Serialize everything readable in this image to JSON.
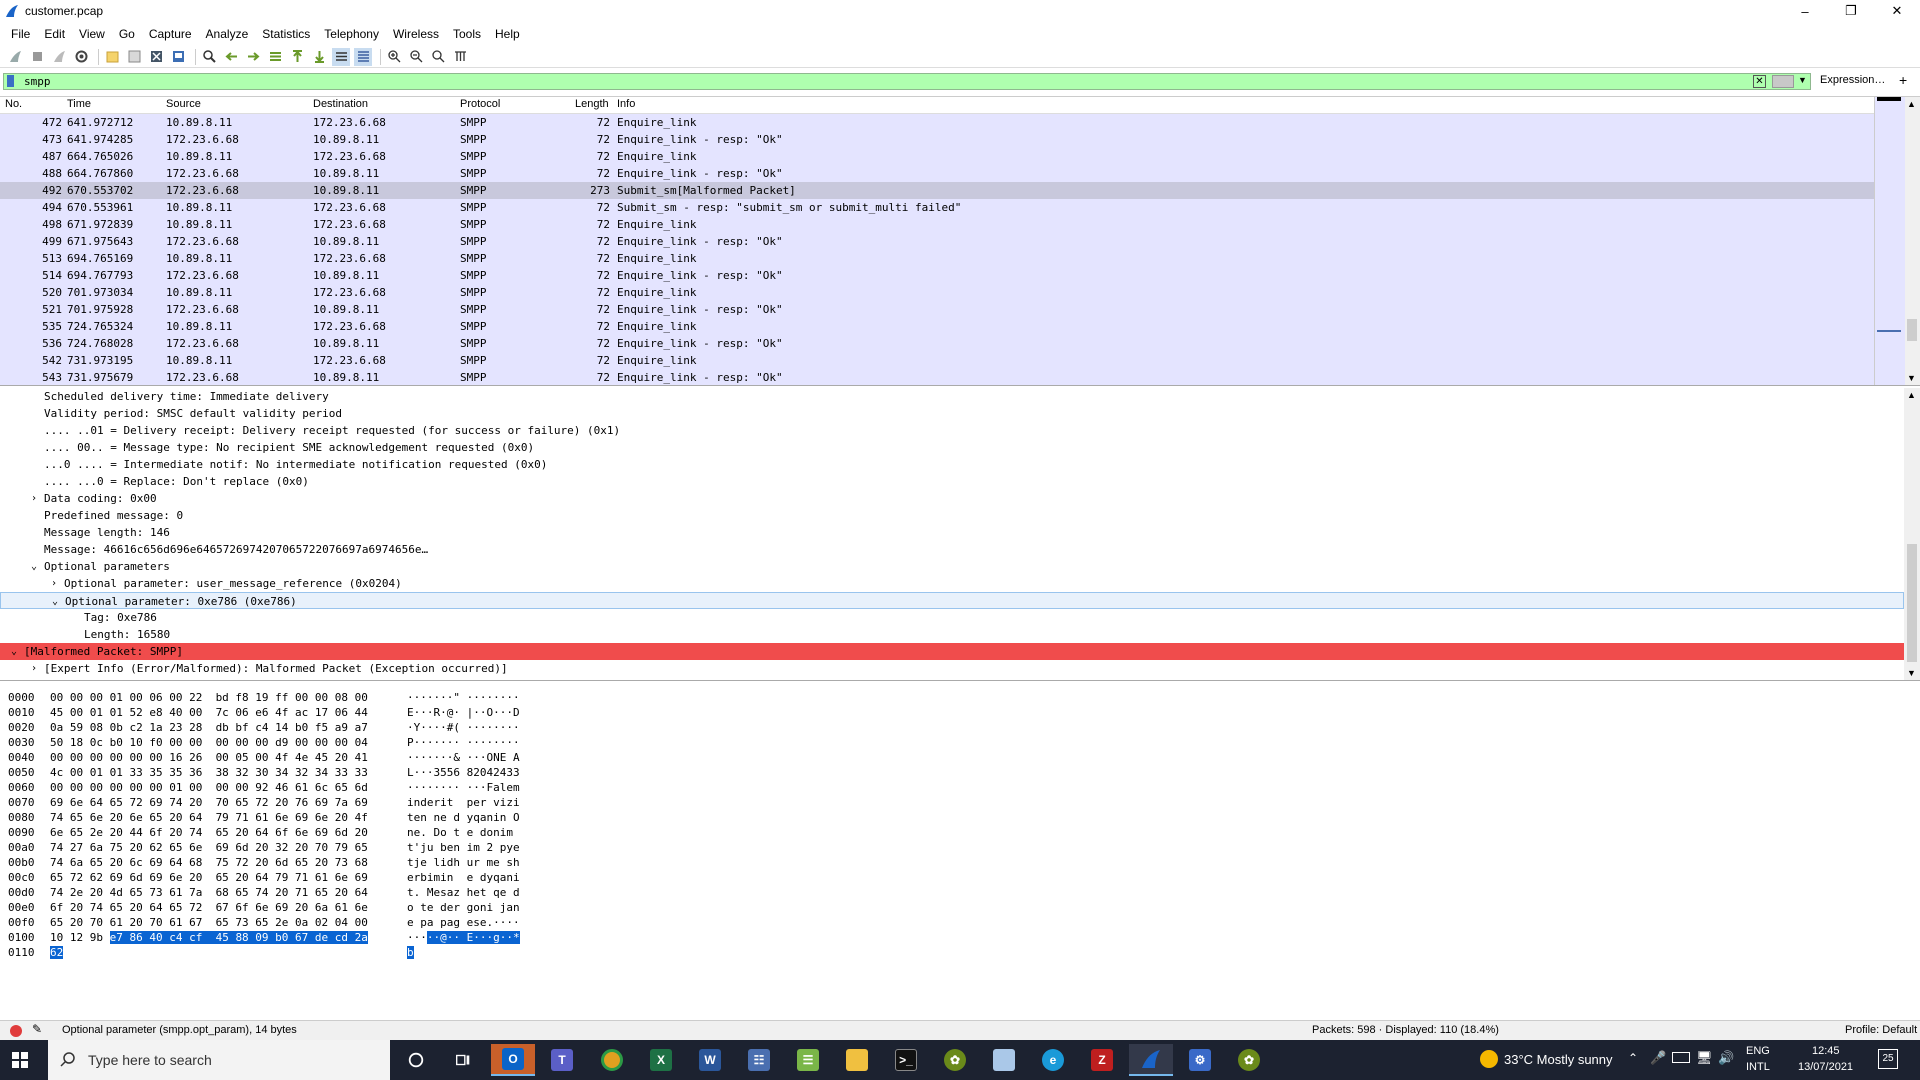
{
  "window": {
    "title": "customer.pcap"
  },
  "menu": [
    "File",
    "Edit",
    "View",
    "Go",
    "Capture",
    "Analyze",
    "Statistics",
    "Telephony",
    "Wireless",
    "Tools",
    "Help"
  ],
  "filter": {
    "value": "smpp",
    "expression_label": "Expression…",
    "plus_label": "+"
  },
  "packet_list": {
    "headers": {
      "no": "No.",
      "time": "Time",
      "source": "Source",
      "destination": "Destination",
      "protocol": "Protocol",
      "length": "Length",
      "info": "Info"
    },
    "rows": [
      {
        "no": "472",
        "time": "641.972712",
        "src": "10.89.8.11",
        "dst": "172.23.6.68",
        "proto": "SMPP",
        "len": "72",
        "info": "Enquire_link"
      },
      {
        "no": "473",
        "time": "641.974285",
        "src": "172.23.6.68",
        "dst": "10.89.8.11",
        "proto": "SMPP",
        "len": "72",
        "info": "Enquire_link - resp: \"Ok\""
      },
      {
        "no": "487",
        "time": "664.765026",
        "src": "10.89.8.11",
        "dst": "172.23.6.68",
        "proto": "SMPP",
        "len": "72",
        "info": "Enquire_link"
      },
      {
        "no": "488",
        "time": "664.767860",
        "src": "172.23.6.68",
        "dst": "10.89.8.11",
        "proto": "SMPP",
        "len": "72",
        "info": "Enquire_link - resp: \"Ok\""
      },
      {
        "no": "492",
        "time": "670.553702",
        "src": "172.23.6.68",
        "dst": "10.89.8.11",
        "proto": "SMPP",
        "len": "273",
        "info": "Submit_sm[Malformed Packet]",
        "selected": true
      },
      {
        "no": "494",
        "time": "670.553961",
        "src": "10.89.8.11",
        "dst": "172.23.6.68",
        "proto": "SMPP",
        "len": "72",
        "info": "Submit_sm - resp: \"submit_sm or submit_multi failed\""
      },
      {
        "no": "498",
        "time": "671.972839",
        "src": "10.89.8.11",
        "dst": "172.23.6.68",
        "proto": "SMPP",
        "len": "72",
        "info": "Enquire_link"
      },
      {
        "no": "499",
        "time": "671.975643",
        "src": "172.23.6.68",
        "dst": "10.89.8.11",
        "proto": "SMPP",
        "len": "72",
        "info": "Enquire_link - resp: \"Ok\""
      },
      {
        "no": "513",
        "time": "694.765169",
        "src": "10.89.8.11",
        "dst": "172.23.6.68",
        "proto": "SMPP",
        "len": "72",
        "info": "Enquire_link"
      },
      {
        "no": "514",
        "time": "694.767793",
        "src": "172.23.6.68",
        "dst": "10.89.8.11",
        "proto": "SMPP",
        "len": "72",
        "info": "Enquire_link - resp: \"Ok\""
      },
      {
        "no": "520",
        "time": "701.973034",
        "src": "10.89.8.11",
        "dst": "172.23.6.68",
        "proto": "SMPP",
        "len": "72",
        "info": "Enquire_link"
      },
      {
        "no": "521",
        "time": "701.975928",
        "src": "172.23.6.68",
        "dst": "10.89.8.11",
        "proto": "SMPP",
        "len": "72",
        "info": "Enquire_link - resp: \"Ok\""
      },
      {
        "no": "535",
        "time": "724.765324",
        "src": "10.89.8.11",
        "dst": "172.23.6.68",
        "proto": "SMPP",
        "len": "72",
        "info": "Enquire_link"
      },
      {
        "no": "536",
        "time": "724.768028",
        "src": "172.23.6.68",
        "dst": "10.89.8.11",
        "proto": "SMPP",
        "len": "72",
        "info": "Enquire_link - resp: \"Ok\""
      },
      {
        "no": "542",
        "time": "731.973195",
        "src": "10.89.8.11",
        "dst": "172.23.6.68",
        "proto": "SMPP",
        "len": "72",
        "info": "Enquire_link"
      },
      {
        "no": "543",
        "time": "731.975679",
        "src": "172.23.6.68",
        "dst": "10.89.8.11",
        "proto": "SMPP",
        "len": "72",
        "info": "Enquire_link - resp: \"Ok\""
      }
    ]
  },
  "details": [
    {
      "level": 2,
      "arrow": "",
      "text": "Scheduled delivery time: Immediate delivery"
    },
    {
      "level": 2,
      "arrow": "",
      "text": "Validity period: SMSC default validity period"
    },
    {
      "level": 2,
      "arrow": "",
      "text": ".... ..01 = Delivery receipt: Delivery receipt requested (for success or failure) (0x1)"
    },
    {
      "level": 2,
      "arrow": "",
      "text": ".... 00.. = Message type: No recipient SME acknowledgement requested (0x0)"
    },
    {
      "level": 2,
      "arrow": "",
      "text": "...0 .... = Intermediate notif: No intermediate notification requested (0x0)"
    },
    {
      "level": 2,
      "arrow": "",
      "text": ".... ...0 = Replace: Don't replace (0x0)"
    },
    {
      "level": 2,
      "arrow": "›",
      "text": "Data coding: 0x00"
    },
    {
      "level": 2,
      "arrow": "",
      "text": "Predefined message: 0"
    },
    {
      "level": 2,
      "arrow": "",
      "text": "Message length: 146"
    },
    {
      "level": 2,
      "arrow": "",
      "text": "Message: 46616c656d696e6465726974207065722076697a6974656e…"
    },
    {
      "level": 2,
      "arrow": "⌄",
      "text": "Optional parameters"
    },
    {
      "level": 3,
      "arrow": "›",
      "text": "Optional parameter: user_message_reference (0x0204)"
    },
    {
      "level": 3,
      "arrow": "⌄",
      "text": "Optional parameter: 0xe786 (0xe786)",
      "highlight": true
    },
    {
      "level": 4,
      "arrow": "",
      "text": "Tag: 0xe786"
    },
    {
      "level": 4,
      "arrow": "",
      "text": "Length: 16580"
    },
    {
      "level": 1,
      "arrow": "⌄",
      "text": "[Malformed Packet: SMPP]",
      "error": true
    },
    {
      "level": 2,
      "arrow": "›",
      "text": "[Expert Info (Error/Malformed): Malformed Packet (Exception occurred)]"
    }
  ],
  "bytes": [
    {
      "off": "0000",
      "hex": "00 00 00 01 00 06 00 22  bd f8 19 ff 00 00 08 00",
      "asc": "·······\" ········"
    },
    {
      "off": "0010",
      "hex": "45 00 01 01 52 e8 40 00  7c 06 e6 4f ac 17 06 44",
      "asc": "E···R·@· |··O···D"
    },
    {
      "off": "0020",
      "hex": "0a 59 08 0b c2 1a 23 28  db bf c4 14 b0 f5 a9 a7",
      "asc": "·Y····#( ········"
    },
    {
      "off": "0030",
      "hex": "50 18 0c b0 10 f0 00 00  00 00 00 d9 00 00 00 04",
      "asc": "P······· ········"
    },
    {
      "off": "0040",
      "hex": "00 00 00 00 00 00 16 26  00 05 00 4f 4e 45 20 41",
      "asc": "·······& ···ONE A"
    },
    {
      "off": "0050",
      "hex": "4c 00 01 01 33 35 35 36  38 32 30 34 32 34 33 33",
      "asc": "L···3556 82042433"
    },
    {
      "off": "0060",
      "hex": "00 00 00 00 00 00 01 00  00 00 92 46 61 6c 65 6d",
      "asc": "········ ···Falem"
    },
    {
      "off": "0070",
      "hex": "69 6e 64 65 72 69 74 20  70 65 72 20 76 69 7a 69",
      "asc": "inderit  per vizi"
    },
    {
      "off": "0080",
      "hex": "74 65 6e 20 6e 65 20 64  79 71 61 6e 69 6e 20 4f",
      "asc": "ten ne d yqanin O"
    },
    {
      "off": "0090",
      "hex": "6e 65 2e 20 44 6f 20 74  65 20 64 6f 6e 69 6d 20",
      "asc": "ne. Do t e donim "
    },
    {
      "off": "00a0",
      "hex": "74 27 6a 75 20 62 65 6e  69 6d 20 32 20 70 79 65",
      "asc": "t'ju ben im 2 pye"
    },
    {
      "off": "00b0",
      "hex": "74 6a 65 20 6c 69 64 68  75 72 20 6d 65 20 73 68",
      "asc": "tje lidh ur me sh"
    },
    {
      "off": "00c0",
      "hex": "65 72 62 69 6d 69 6e 20  65 20 64 79 71 61 6e 69",
      "asc": "erbimin  e dyqani"
    },
    {
      "off": "00d0",
      "hex": "74 2e 20 4d 65 73 61 7a  68 65 74 20 71 65 20 64",
      "asc": "t. Mesaz het qe d"
    },
    {
      "off": "00e0",
      "hex": "6f 20 74 65 20 64 65 72  67 6f 6e 69 20 6a 61 6e",
      "asc": "o te der goni jan"
    },
    {
      "off": "00f0",
      "hex": "65 20 70 61 20 70 61 67  65 73 65 2e 0a 02 04 00",
      "asc": "e pa pag ese.····"
    },
    {
      "off": "0100",
      "hex_pre": "10 12 9b ",
      "hex_sel": "e7 86 40 c4 cf  45 88 09 b0 67 de cd 2a",
      "asc_pre": "···",
      "asc_sel": "··@·· E···g··*"
    },
    {
      "off": "0110",
      "hex_pre": "",
      "hex_sel": "62",
      "asc_pre": "",
      "asc_sel": "b"
    }
  ],
  "status": {
    "field": "Optional parameter (smpp.opt_param), 14 bytes",
    "packets": "Packets: 598 · Displayed: 110 (18.4%)",
    "profile": "Profile: Default"
  },
  "taskbar": {
    "search_placeholder": "Type here to search",
    "weather": "33°C  Mostly sunny",
    "lang1": "ENG",
    "lang2": "INTL",
    "time": "12:45",
    "date": "13/07/2021",
    "notif": "25"
  },
  "colors": {
    "row_bg": "#e4e4ff",
    "row_selected": "#c8c8dc",
    "filter_ok": "#afffaf",
    "error_row": "#f04c4c",
    "byte_selection": "#0a64d2"
  }
}
